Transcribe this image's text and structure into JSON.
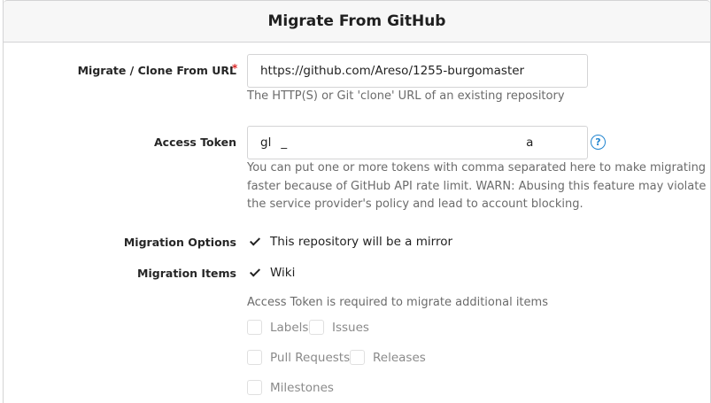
{
  "header": {
    "title": "Migrate From GitHub"
  },
  "clone_url": {
    "label": "Migrate / Clone From URL",
    "required_mark": "*",
    "value": "https://github.com/Areso/1255-burgomaster",
    "help": "The HTTP(S) or Git 'clone' URL of an existing repository"
  },
  "access_token": {
    "label": "Access Token",
    "value_start": "gl",
    "value_mid": "_",
    "value_end": "a",
    "help_icon": "question-circle-icon",
    "help_icon_glyph": "?",
    "help_line1": "You can put one or more tokens with comma separated here to make migrating",
    "help_line2": "faster because of GitHub API rate limit. WARN: Abusing this feature may violate",
    "help_line3": "the service provider's policy and lead to account blocking."
  },
  "migration_options": {
    "label": "Migration Options",
    "mirror_label": "This repository will be a mirror",
    "mirror_checked": true
  },
  "migration_items": {
    "label": "Migration Items",
    "wiki_label": "Wiki",
    "wiki_checked": true,
    "token_note": "Access Token is required to migrate additional items",
    "labels_label": "Labels",
    "issues_label": "Issues",
    "pull_requests_label": "Pull Requests",
    "releases_label": "Releases",
    "milestones_label": "Milestones"
  },
  "colors": {
    "required": "#db2828",
    "help_icon": "#2185d0",
    "header_bg": "#f7f7f7"
  }
}
